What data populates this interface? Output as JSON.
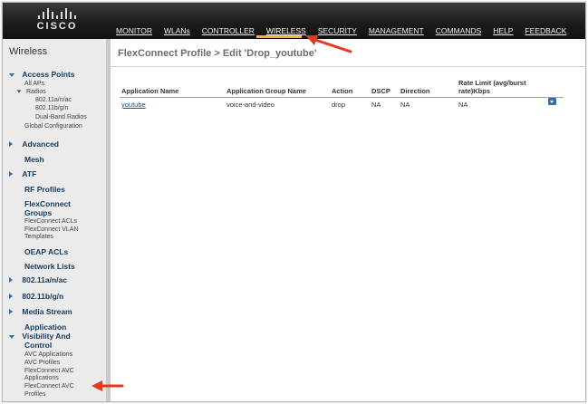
{
  "header": {
    "logo_text": "CISCO",
    "menu": [
      "MONITOR",
      "WLANs",
      "CONTROLLER",
      "WIRELESS",
      "SECURITY",
      "MANAGEMENT",
      "COMMANDS",
      "HELP",
      "FEEDBACK"
    ],
    "active_menu": "WIRELESS"
  },
  "sidebar": {
    "title": "Wireless",
    "access_points": "Access Points",
    "all_aps": "All APs",
    "radios": "Radios",
    "radio_a": "802.11a/n/ac",
    "radio_b": "802.11b/g/n",
    "dual_band": "Dual-Band Radios",
    "global_config": "Global Configuration",
    "advanced": "Advanced",
    "mesh": "Mesh",
    "atf": "ATF",
    "rf_profiles": "RF Profiles",
    "flex_groups_1": "FlexConnect",
    "flex_groups_2": "Groups",
    "flex_acls": "FlexConnect ACLs",
    "flex_vlan_1": "FlexConnect VLAN",
    "flex_vlan_2": "Templates",
    "oeap": "OEAP ACLs",
    "network_lists": "Network Lists",
    "a_group": "802.11a/n/ac",
    "b_group": "802.11b/g/n",
    "media_stream": "Media Stream",
    "avc_1": "Application",
    "avc_2": "Visibility And",
    "avc_3": "Control",
    "avc_apps": "AVC Applications",
    "avc_profiles": "AVC Profiles",
    "flex_avc_apps_1": "FlexConnect AVC",
    "flex_avc_apps_2": "Applications",
    "flex_avc_profiles_1": "FlexConnect AVC",
    "flex_avc_profiles_2": "Profiles"
  },
  "main": {
    "title": "FlexConnect Profile > Edit  'Drop_youtube'",
    "columns": {
      "app_name": "Application Name",
      "app_group": "Application Group Name",
      "action": "Action",
      "dscp": "DSCP",
      "direction": "Direction",
      "rate_limit_1": "Rate Limit (avg/burst",
      "rate_limit_2": "rate)Kbps"
    },
    "rows": [
      {
        "app_name": "youtube",
        "app_group": "voice-and-video",
        "action": "drop",
        "dscp": "NA",
        "direction": "NA",
        "rate_limit": "NA"
      }
    ]
  },
  "colors": {
    "header_bg": "#1b1b1b",
    "active_underline": "#f0b838",
    "link": "#1a4e8a",
    "callout_arrow": "#e03a1e"
  },
  "icons": [
    "dropdown-icon",
    "expand-arrow-icon",
    "collapse-arrow-icon",
    "callout-arrow-icon"
  ]
}
